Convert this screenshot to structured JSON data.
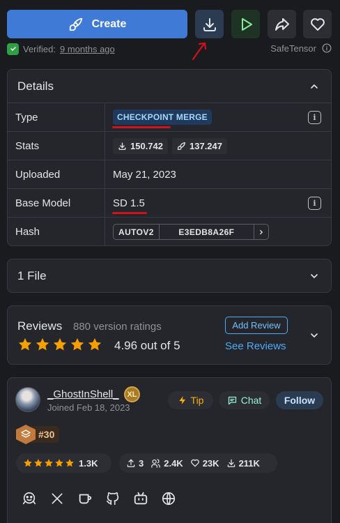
{
  "toolbar": {
    "create_label": "Create"
  },
  "verified": {
    "prefix": "Verified:",
    "time": "9 months ago",
    "format": "SafeTensor"
  },
  "details": {
    "title": "Details",
    "rows": {
      "type_label": "Type",
      "type_value": "CHECKPOINT MERGE",
      "stats_label": "Stats",
      "downloads": "150.742",
      "generations": "137.247",
      "uploaded_label": "Uploaded",
      "uploaded_value": "May 21, 2023",
      "base_label": "Base Model",
      "base_value": "SD 1.5",
      "hash_label": "Hash",
      "hash_type": "AUTOV2",
      "hash_value": "E3EDB8A26F"
    }
  },
  "files": {
    "title": "1 File"
  },
  "reviews": {
    "title": "Reviews",
    "count": "880 version ratings",
    "score": "4.96 out of 5",
    "rating": 5,
    "add_label": "Add Review",
    "see_label": "See Reviews"
  },
  "creator": {
    "username": "_GhostInShell_",
    "level_badge": "XL",
    "joined": "Joined Feb 18, 2023",
    "tip_label": "Tip",
    "chat_label": "Chat",
    "follow_label": "Follow",
    "rank": "#30",
    "rating_count": "1.3K",
    "uploads": "3",
    "followers": "2.4K",
    "likes": "23K",
    "downloads": "211K"
  },
  "colors": {
    "accent": "#3f7ad6",
    "annotation": "#d0121b",
    "star": "#f59f00"
  }
}
